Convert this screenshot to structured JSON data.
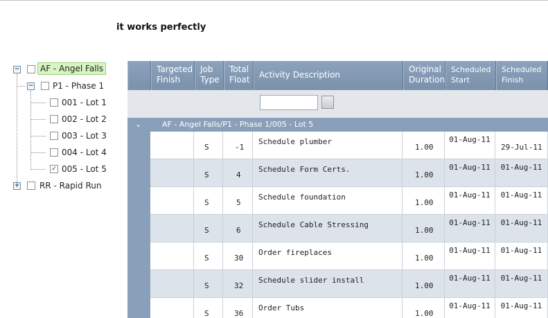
{
  "heading": "it works perfectly",
  "tree": {
    "root1": {
      "label": "AF - Angel Falls",
      "expander": "−"
    },
    "phase": {
      "label": "P1 - Phase 1",
      "expander": "−"
    },
    "lots": [
      {
        "label": "001 - Lot 1",
        "checked": ""
      },
      {
        "label": "002 - Lot 2",
        "checked": ""
      },
      {
        "label": "003 - Lot 3",
        "checked": ""
      },
      {
        "label": "004 - Lot 4",
        "checked": ""
      },
      {
        "label": "005 - Lot 5",
        "checked": "✓"
      }
    ],
    "root2": {
      "label": "RR - Rapid Run",
      "expander": "+"
    }
  },
  "grid": {
    "columns": {
      "targeted_finish": "Targeted Finish",
      "job_type": "Job Type",
      "total_float": "Total Float",
      "activity": "Activity Description",
      "orig_duration": "Original Duration",
      "sched_start": "Scheduled Start",
      "sched_finish": "Scheduled Finish"
    },
    "group_chevron": "⌄",
    "group_label": "AF - Angel Falls/P1 - Phase 1/005 - Lot 5",
    "rows": [
      {
        "job_type": "S",
        "total_float": "-1",
        "activity": "Schedule plumber",
        "duration": "1.00",
        "start": "01-Aug-11",
        "finish": "29-Jul-11"
      },
      {
        "job_type": "S",
        "total_float": "4",
        "activity": "Schedule Form Certs.",
        "duration": "1.00",
        "start": "01-Aug-11",
        "finish": "01-Aug-11"
      },
      {
        "job_type": "S",
        "total_float": "5",
        "activity": "Schedule foundation",
        "duration": "1.00",
        "start": "01-Aug-11",
        "finish": "01-Aug-11"
      },
      {
        "job_type": "S",
        "total_float": "6",
        "activity": "Schedule Cable Stressing",
        "duration": "1.00",
        "start": "01-Aug-11",
        "finish": "01-Aug-11"
      },
      {
        "job_type": "S",
        "total_float": "30",
        "activity": "Order fireplaces",
        "duration": "1.00",
        "start": "01-Aug-11",
        "finish": "01-Aug-11"
      },
      {
        "job_type": "S",
        "total_float": "32",
        "activity": "Schedule slider install",
        "duration": "1.00",
        "start": "01-Aug-11",
        "finish": "01-Aug-11"
      },
      {
        "job_type": "S",
        "total_float": "36",
        "activity": "Order Tubs",
        "duration": "1.00",
        "start": "01-Aug-11",
        "finish": "01-Aug-11"
      }
    ]
  }
}
